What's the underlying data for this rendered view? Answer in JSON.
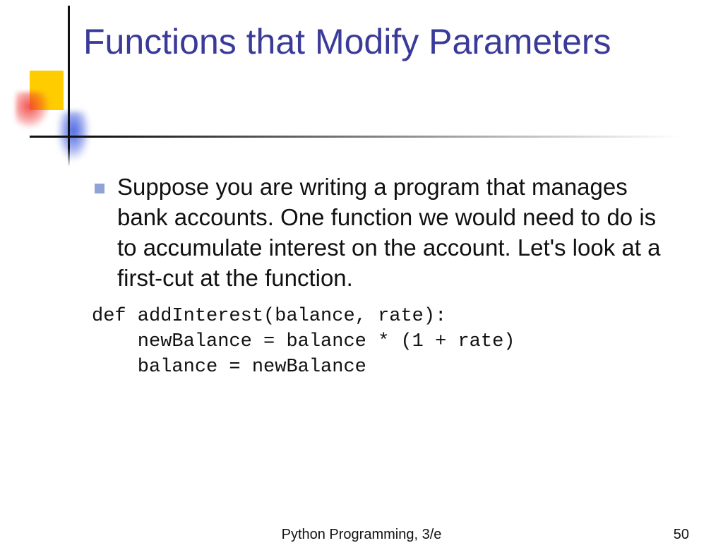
{
  "title": "Functions that Modify Parameters",
  "bullet": "Suppose you are writing a program that manages bank accounts. One function we would need to do is to accumulate interest on the account. Let's look at a first-cut at the function.",
  "code": "def addInterest(balance, rate):\n    newBalance = balance * (1 + rate)\n    balance = newBalance",
  "footer": {
    "center": "Python Programming, 3/e",
    "page": "50"
  }
}
